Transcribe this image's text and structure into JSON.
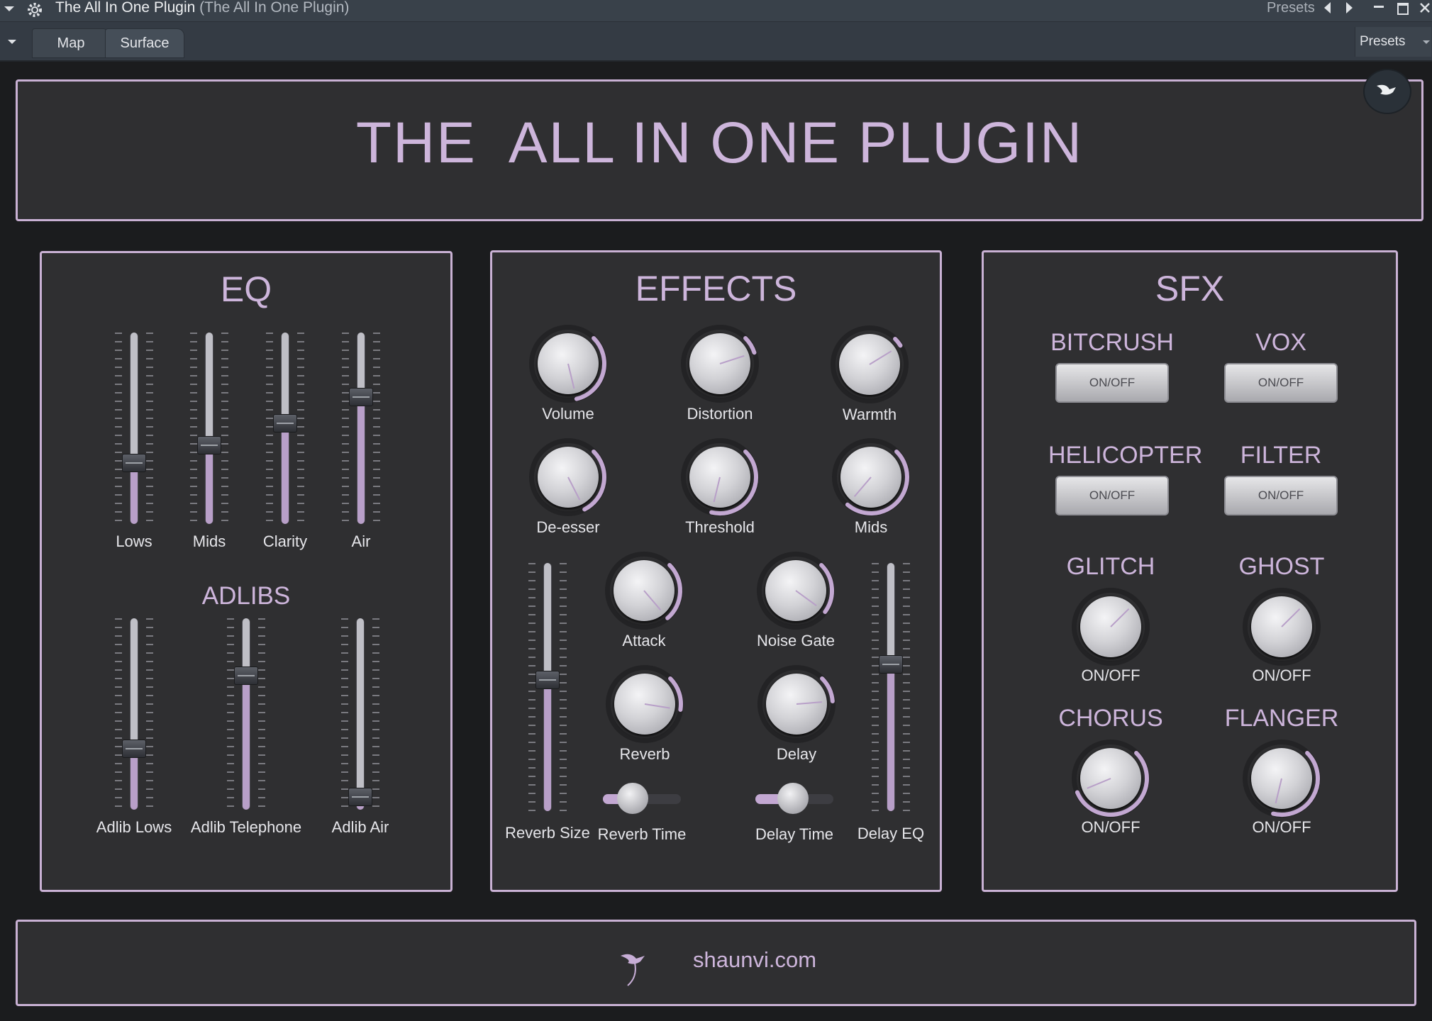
{
  "window": {
    "title": "The All In One Plugin",
    "subtitle": "(The All In One Plugin)",
    "presets_label": "Presets"
  },
  "toolbar": {
    "tabs": [
      {
        "label": "Map"
      },
      {
        "label": "Surface"
      }
    ],
    "presets_button": "Presets"
  },
  "header": {
    "title": "THE  ALL IN ONE PLUGIN"
  },
  "eq": {
    "title": "EQ",
    "sliders": [
      {
        "label": "Lows",
        "value": 0.3
      },
      {
        "label": "Mids",
        "value": 0.4
      },
      {
        "label": "Clarity",
        "value": 0.53
      },
      {
        "label": "Air",
        "value": 0.68
      }
    ],
    "adlibs_title": "ADLIBS",
    "adlib_sliders": [
      {
        "label": "Adlib Lows",
        "value": 0.3
      },
      {
        "label": "Adlib Telephone",
        "value": 0.72
      },
      {
        "label": "Adlib Air",
        "value": 0.02
      }
    ]
  },
  "effects": {
    "title": "EFFECTS",
    "knobs": [
      {
        "label": "Volume",
        "value": 0.45
      },
      {
        "label": "Distortion",
        "value": 0.1
      },
      {
        "label": "Warmth",
        "value": 0.05
      },
      {
        "label": "De-esser",
        "value": 0.4
      },
      {
        "label": "Threshold",
        "value": 0.55
      },
      {
        "label": "Mids",
        "value": 0.65
      },
      {
        "label": "Attack",
        "value": 0.35
      },
      {
        "label": "Noise Gate",
        "value": 0.3
      },
      {
        "label": "Reverb",
        "value": 0.2
      },
      {
        "label": "Delay",
        "value": 0.15
      }
    ],
    "reverb_size": {
      "label": "Reverb Size",
      "value": 0.53
    },
    "delay_eq": {
      "label": "Delay EQ",
      "value": 0.6
    },
    "reverb_time": {
      "label": "Reverb Time",
      "value": 0.25
    },
    "delay_time": {
      "label": "Delay Time",
      "value": 0.35
    }
  },
  "sfx": {
    "title": "SFX",
    "toggles": [
      {
        "title": "BITCRUSH",
        "button": "ON/OFF"
      },
      {
        "title": "VOX",
        "button": "ON/OFF"
      },
      {
        "title": "HELICOPTER",
        "button": "ON/OFF"
      },
      {
        "title": "FILTER",
        "button": "ON/OFF"
      }
    ],
    "knobs": [
      {
        "title": "GLITCH",
        "label": "ON/OFF",
        "value": 0.0
      },
      {
        "title": "GHOST",
        "label": "ON/OFF",
        "value": 0.0
      },
      {
        "title": "CHORUS",
        "label": "ON/OFF",
        "value": 0.75
      },
      {
        "title": "FLANGER",
        "label": "ON/OFF",
        "value": 0.55
      }
    ]
  },
  "footer": {
    "website": "shaunvi.com"
  },
  "colors": {
    "accent": "#cdb5db",
    "panel": "#2f2f31",
    "background": "#1b1c1e",
    "titlebar": "#39414a"
  }
}
